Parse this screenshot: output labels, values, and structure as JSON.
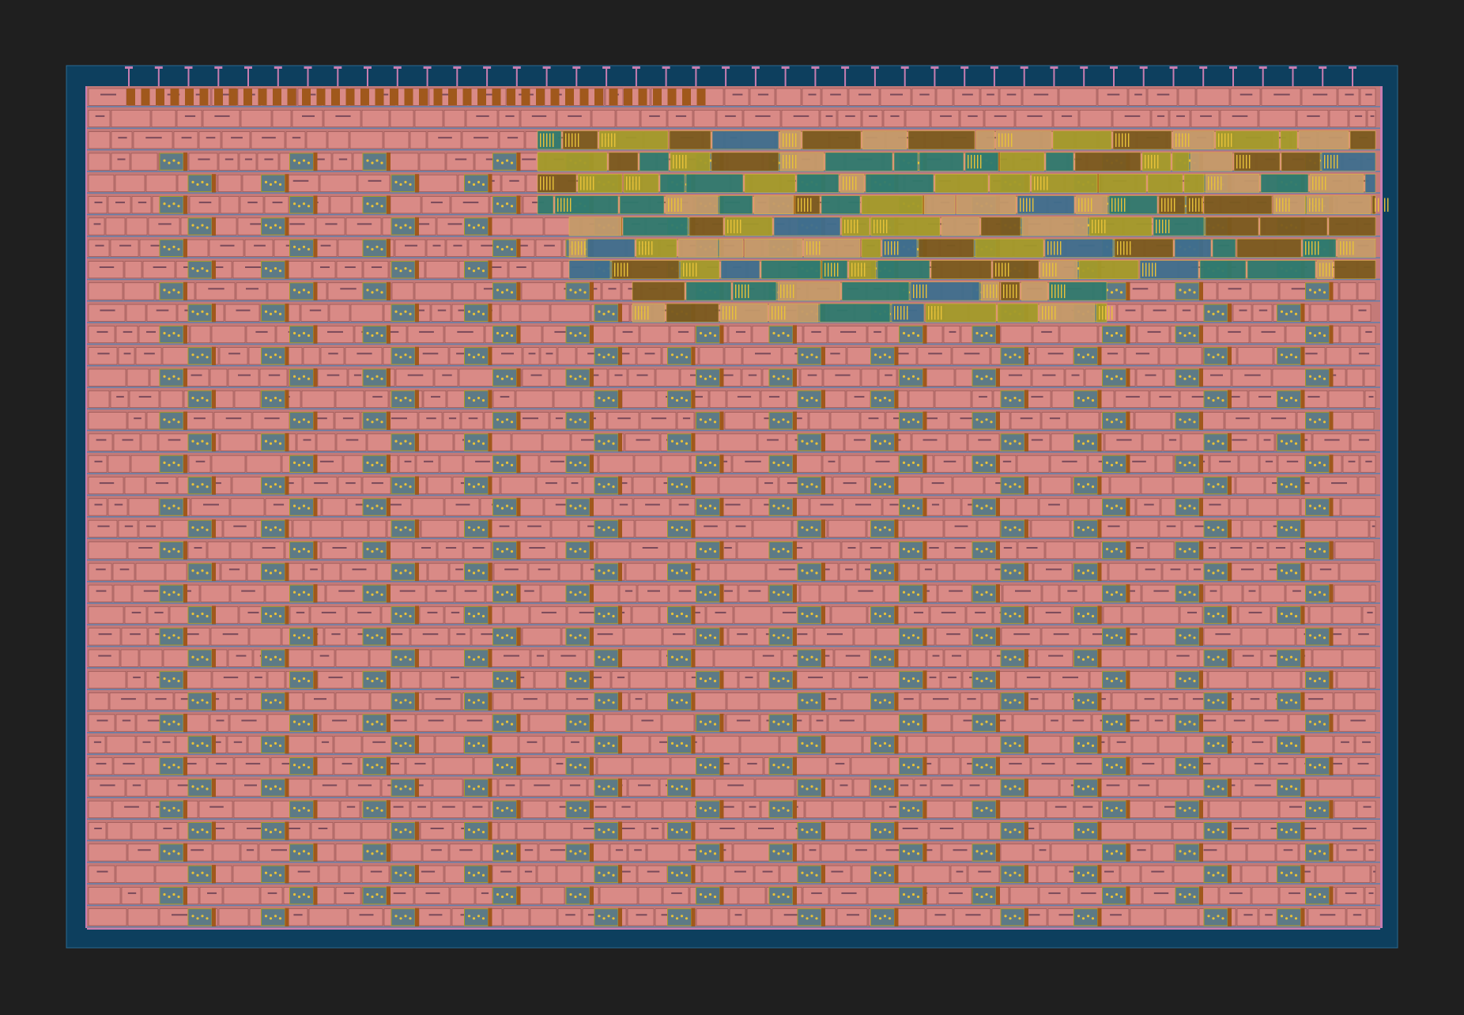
{
  "layout_view": {
    "background_color": "#1f1f1f",
    "die_color": "#0d3f5e",
    "die_edge_color": "#2a6a90",
    "core_fill_color": "#c47a78",
    "layers": [
      {
        "name": "metal1",
        "color": "#d98a86"
      },
      {
        "name": "metal2",
        "color": "#5b7fb0"
      },
      {
        "name": "metal3",
        "color": "#9c7a4a"
      },
      {
        "name": "via",
        "color": "#e8c23a"
      },
      {
        "name": "poly",
        "color": "#a39a2a"
      },
      {
        "name": "diffusion",
        "color": "#2f7a6e"
      },
      {
        "name": "nwell",
        "color": "#a0581c"
      },
      {
        "name": "pin",
        "color": "#c77db0"
      }
    ],
    "core_rows": 39,
    "top_pins": 42,
    "macro_columns": 13
  }
}
